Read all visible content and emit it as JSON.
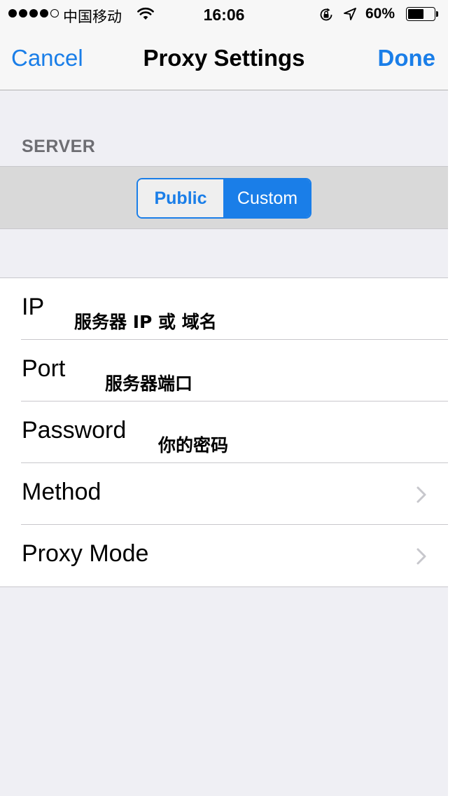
{
  "status_bar": {
    "signal_dots": [
      true,
      true,
      true,
      true,
      false
    ],
    "carrier": "中国移动",
    "time": "16:06",
    "battery_percent_label": "60%",
    "battery_level": 0.6
  },
  "nav": {
    "cancel_label": "Cancel",
    "title": "Proxy Settings",
    "done_label": "Done"
  },
  "server": {
    "section_header": "SERVER",
    "segments": [
      {
        "label": "Public",
        "selected": false
      },
      {
        "label": "Custom",
        "selected": true
      }
    ]
  },
  "rows": [
    {
      "label": "IP",
      "hint": "服务器 IP 或 域名",
      "disclosure": false
    },
    {
      "label": "Port",
      "hint": "服务器端口",
      "disclosure": false
    },
    {
      "label": "Password",
      "hint": "你的密码",
      "disclosure": false
    },
    {
      "label": "Method",
      "hint": "",
      "disclosure": true
    },
    {
      "label": "Proxy Mode",
      "hint": "",
      "disclosure": true
    }
  ],
  "colors": {
    "accent": "#1a7ee8",
    "background": "#efeff4",
    "bar": "#f7f7f7",
    "separator": "#c8c7cc",
    "chevron": "#c7c7cc"
  },
  "icons": [
    "wifi-icon",
    "rotation-lock-icon",
    "location-arrow-icon",
    "battery-icon",
    "chevron-right-icon"
  ]
}
